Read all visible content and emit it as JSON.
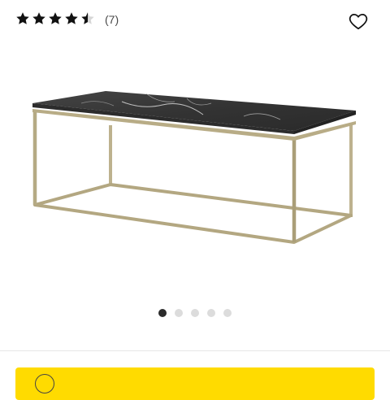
{
  "rating": {
    "value": 4.5,
    "max": 5,
    "review_count": "(7)",
    "filled_color": "#111111",
    "empty_color": "#d6d6d6"
  },
  "wishlist": {
    "icon": "heart-outline-icon"
  },
  "product_image": {
    "description_icon": "coffee-table-image",
    "top_color": "#3a3a3a",
    "frame_color": "#b8ac86"
  },
  "carousel": {
    "total": 5,
    "active_index": 0
  },
  "cta": {
    "label": "",
    "icon": "circle-icon",
    "color": "#ffdb00"
  }
}
